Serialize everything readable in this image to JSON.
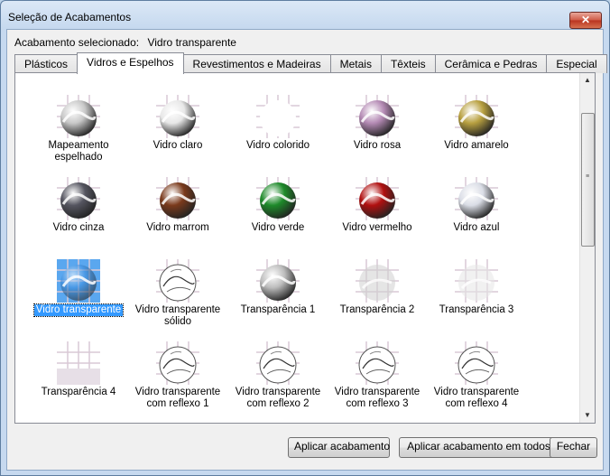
{
  "window": {
    "title": "Seleção de Acabamentos",
    "close_glyph": "✕"
  },
  "selected": {
    "label": "Acabamento selecionado:",
    "value": "Vidro transparente"
  },
  "tabs": [
    {
      "label": "Plásticos",
      "active": false
    },
    {
      "label": "Vidros e Espelhos",
      "active": true
    },
    {
      "label": "Revestimentos e Madeiras",
      "active": false
    },
    {
      "label": "Metais",
      "active": false
    },
    {
      "label": "Têxteis",
      "active": false
    },
    {
      "label": "Cerâmica e Pedras",
      "active": false
    },
    {
      "label": "Especial",
      "active": false
    }
  ],
  "items": [
    {
      "label": "Mapeamento espelhado",
      "color": "#c8c8c8",
      "style": "chrome"
    },
    {
      "label": "Vidro claro",
      "color": "#e8e8e8",
      "style": "chrome"
    },
    {
      "label": "Vidro colorido",
      "color": "#ffffff",
      "style": "white"
    },
    {
      "label": "Vidro rosa",
      "color": "#b48ab4",
      "style": "glass"
    },
    {
      "label": "Vidro amarelo",
      "color": "#b8a040",
      "style": "glass"
    },
    {
      "label": "Vidro cinza",
      "color": "#555560",
      "style": "glass"
    },
    {
      "label": "Vidro marrom",
      "color": "#7a3a1c",
      "style": "glass"
    },
    {
      "label": "Vidro verde",
      "color": "#1e8a2a",
      "style": "glass"
    },
    {
      "label": "Vidro vermelho",
      "color": "#b01010",
      "style": "glass"
    },
    {
      "label": "Vidro azul",
      "color": "#dadde6",
      "style": "chrome"
    },
    {
      "label": "Vidro transparente",
      "color": "#3d8fe0",
      "style": "selected"
    },
    {
      "label": "Vidro transparente sólido",
      "color": "#ffffff",
      "style": "sketch"
    },
    {
      "label": "Transparência 1",
      "color": "#bdbdbd",
      "style": "chrome"
    },
    {
      "label": "Transparência 2",
      "color": "#cfcfcf",
      "style": "faint"
    },
    {
      "label": "Transparência 3",
      "color": "#e6e6e6",
      "style": "faint"
    },
    {
      "label": "Transparência 4",
      "color": "#ffffff",
      "style": "grid"
    },
    {
      "label": "Vidro transparente com reflexo 1",
      "color": "#ffffff",
      "style": "sketch"
    },
    {
      "label": "Vidro transparente com reflexo 2",
      "color": "#ffffff",
      "style": "sketch"
    },
    {
      "label": "Vidro transparente com reflexo 3",
      "color": "#ffffff",
      "style": "sketch"
    },
    {
      "label": "Vidro transparente com reflexo 4",
      "color": "#ffffff",
      "style": "sketch"
    }
  ],
  "selected_index": 10,
  "buttons": {
    "apply": "Aplicar acabamento",
    "apply_all": "Aplicar acabamento em todos",
    "close": "Fechar"
  },
  "scrollbar": {
    "up_glyph": "▲",
    "down_glyph": "▼",
    "grip_glyph": "≡"
  }
}
